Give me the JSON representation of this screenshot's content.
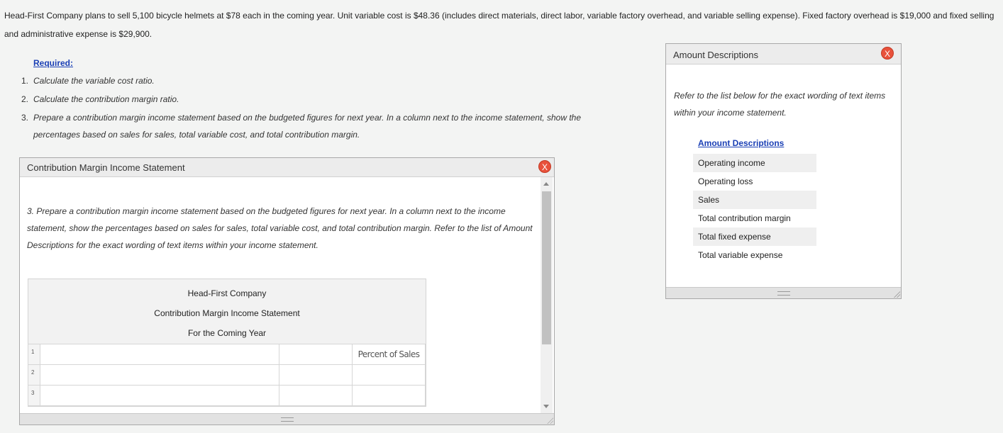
{
  "intro": "Head-First Company plans to sell 5,100 bicycle helmets at $78 each in the coming year. Unit variable cost is $48.36 (includes direct materials, direct labor, variable factory overhead, and variable selling expense). Fixed factory overhead is $19,000 and fixed selling and administrative expense is $29,900.",
  "required": {
    "title": "Required:",
    "items": [
      {
        "num": "1.",
        "text": "Calculate the variable cost ratio."
      },
      {
        "num": "2.",
        "text": "Calculate the contribution margin ratio."
      },
      {
        "num": "3.",
        "text": "Prepare a contribution margin income statement based on the budgeted figures for next year. In a column next to the income statement, show the percentages based on sales for sales, total variable cost, and total contribution margin."
      }
    ]
  },
  "cm_panel": {
    "title": "Contribution Margin Income Statement",
    "close": "X",
    "instructions": "3. Prepare a contribution margin income statement based on the budgeted figures for next year. In a column next to the income statement, show the percentages based on sales for sales, total variable cost, and total contribution margin. Refer to the list of Amount Descriptions for the exact wording of text items within your income statement.",
    "sheet": {
      "company": "Head-First Company",
      "statement": "Contribution Margin Income Statement",
      "period": "For the Coming Year",
      "rows": [
        {
          "num": "1",
          "col1": "",
          "col2": "",
          "col3": "Percent of Sales"
        },
        {
          "num": "2",
          "col1": "",
          "col2": "",
          "col3": ""
        },
        {
          "num": "3",
          "col1": "",
          "col2": "",
          "col3": ""
        }
      ]
    }
  },
  "ad_panel": {
    "title": "Amount Descriptions",
    "close": "X",
    "instructions": "Refer to the list below for the exact wording of text items within your income statement.",
    "list_title": "Amount Descriptions",
    "items": [
      "Operating income",
      "Operating loss",
      "Sales",
      "Total contribution margin",
      "Total fixed expense",
      "Total variable expense"
    ]
  },
  "colors": {
    "link": "#1a3fb5",
    "close_button": "#e8513b",
    "page_bg": "#f3f4f3"
  }
}
